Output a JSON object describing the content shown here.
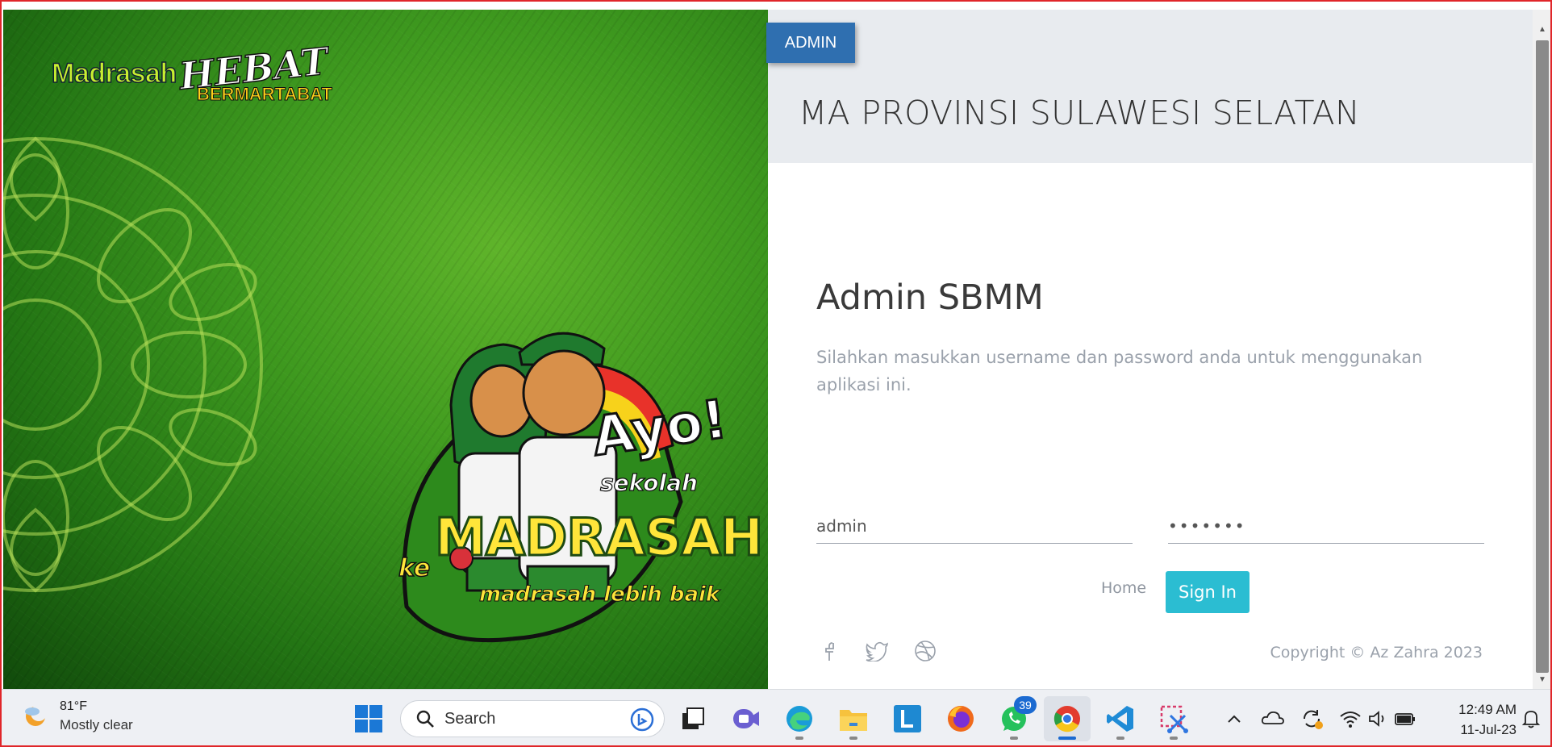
{
  "hero": {
    "brand": {
      "word1": "Madrasah",
      "word2": "HEBAT",
      "word3": "BERMARTABAT"
    },
    "mascot": {
      "ayo": "Ayo!",
      "sekolah": "sekolah",
      "ke": "ke",
      "madrasah": "MADRASAH",
      "tagline": "madrasah lebih baik"
    }
  },
  "header": {
    "tab_label": "ADMIN",
    "site_title": "MA PROVINSI SULAWESI SELATAN"
  },
  "login": {
    "title": "Admin SBMM",
    "description": "Silahkan masukkan username dan password anda untuk menggunakan aplikasi ini.",
    "username_value": "admin",
    "password_value": "•••••••",
    "home_label": "Home",
    "signin_label": "Sign In",
    "social": [
      "facebook-icon",
      "twitter-icon",
      "dribbble-icon"
    ],
    "copyright": "Copyright © Az Zahra 2023"
  },
  "taskbar": {
    "weather": {
      "temp": "81°F",
      "condition": "Mostly clear"
    },
    "search_placeholder": "Search",
    "whatsapp_badge": "39",
    "time": "12:49 AM",
    "date": "11-Jul-23"
  },
  "colors": {
    "accent": "#2f6fb0",
    "signin": "#2bbdd2",
    "header_band": "#e8ebef",
    "hero_green": "#3f9a1f"
  }
}
